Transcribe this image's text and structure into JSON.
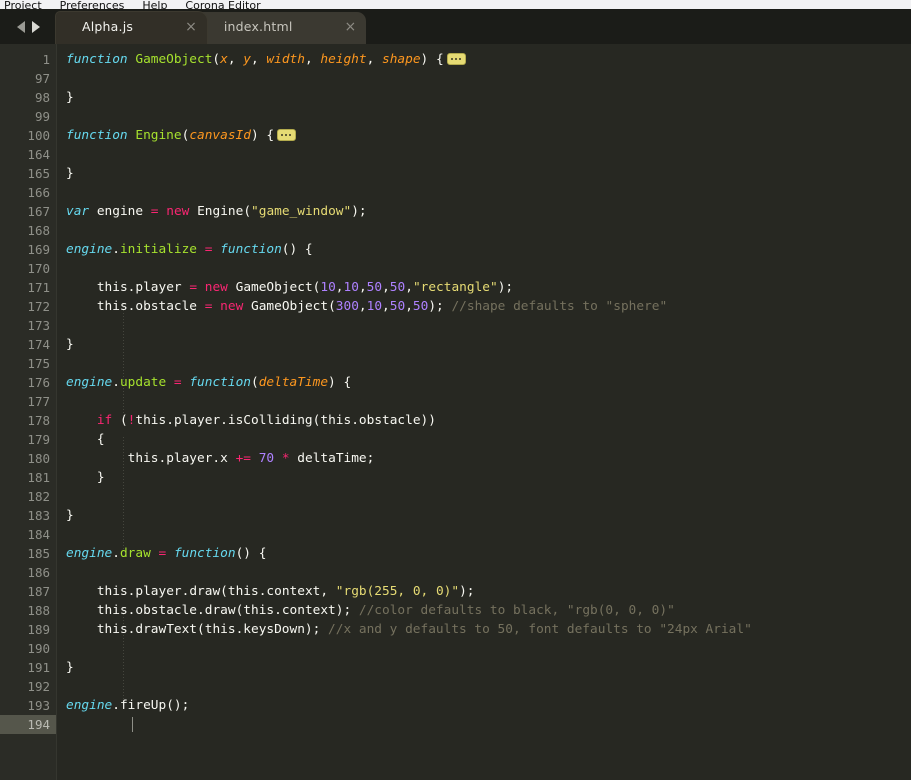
{
  "menubar": {
    "items": [
      "Project",
      "Preferences",
      "Help",
      "Corona Editor"
    ]
  },
  "tabbar": {
    "nav_prev": "◀",
    "nav_next": "▶",
    "close_glyph": "×",
    "tabs": [
      {
        "label": "Alpha.js",
        "active": true
      },
      {
        "label": "index.html",
        "active": false
      }
    ]
  },
  "editor": {
    "colors": {
      "background": "#272822",
      "gutter_background": "#2b2c26",
      "current_line_highlight": "#55564b",
      "keyword": "#66d9ef",
      "function_name": "#a6e22e",
      "parameter": "#fd971f",
      "operator": "#f92672",
      "number": "#ae81ff",
      "string": "#e6db74",
      "comment": "#75715e",
      "plain_text": "#f8f8f2",
      "fold_marker": "#e6db74"
    },
    "current_line": 194,
    "line_numbers": [
      "1",
      "97",
      "98",
      "99",
      "100",
      "164",
      "165",
      "166",
      "167",
      "168",
      "169",
      "170",
      "171",
      "172",
      "173",
      "174",
      "175",
      "176",
      "177",
      "178",
      "179",
      "180",
      "181",
      "182",
      "183",
      "184",
      "185",
      "186",
      "187",
      "188",
      "189",
      "190",
      "191",
      "192",
      "193",
      "194"
    ],
    "lines": [
      {
        "num": "1",
        "text": "function GameObject(x, y, width, height, shape) {"
      },
      {
        "num": "97",
        "text": ""
      },
      {
        "num": "98",
        "text": "}"
      },
      {
        "num": "99",
        "text": ""
      },
      {
        "num": "100",
        "text": "function Engine(canvasId) {"
      },
      {
        "num": "164",
        "text": ""
      },
      {
        "num": "165",
        "text": "}"
      },
      {
        "num": "166",
        "text": ""
      },
      {
        "num": "167",
        "text": "var engine = new Engine(\"game_window\");"
      },
      {
        "num": "168",
        "text": ""
      },
      {
        "num": "169",
        "text": "engine.initialize = function() {"
      },
      {
        "num": "170",
        "text": ""
      },
      {
        "num": "171",
        "text": "    this.player = new GameObject(10,10,50,50,\"rectangle\");"
      },
      {
        "num": "172",
        "text": "    this.obstacle = new GameObject(300,10,50,50); //shape defaults to \"sphere\""
      },
      {
        "num": "173",
        "text": ""
      },
      {
        "num": "174",
        "text": "}"
      },
      {
        "num": "175",
        "text": ""
      },
      {
        "num": "176",
        "text": "engine.update = function(deltaTime) {"
      },
      {
        "num": "177",
        "text": ""
      },
      {
        "num": "178",
        "text": "    if (!this.player.isColliding(this.obstacle))"
      },
      {
        "num": "179",
        "text": "    {"
      },
      {
        "num": "180",
        "text": "        this.player.x += 70 * deltaTime;"
      },
      {
        "num": "181",
        "text": "    }"
      },
      {
        "num": "182",
        "text": ""
      },
      {
        "num": "183",
        "text": "}"
      },
      {
        "num": "184",
        "text": ""
      },
      {
        "num": "185",
        "text": "engine.draw = function() {"
      },
      {
        "num": "186",
        "text": ""
      },
      {
        "num": "187",
        "text": "    this.player.draw(this.context, \"rgb(255, 0, 0)\");"
      },
      {
        "num": "188",
        "text": "    this.obstacle.draw(this.context); //color defaults to black, \"rgb(0, 0, 0)\""
      },
      {
        "num": "189",
        "text": "    this.drawText(this.keysDown); //x and y defaults to 50, font defaults to \"24px Arial\""
      },
      {
        "num": "190",
        "text": ""
      },
      {
        "num": "191",
        "text": "}"
      },
      {
        "num": "192",
        "text": ""
      },
      {
        "num": "193",
        "text": "engine.fireUp();"
      },
      {
        "num": "194",
        "text": ""
      }
    ],
    "fold_markers": [
      {
        "line": "1",
        "label": "…"
      },
      {
        "line": "100",
        "label": "…"
      }
    ]
  }
}
